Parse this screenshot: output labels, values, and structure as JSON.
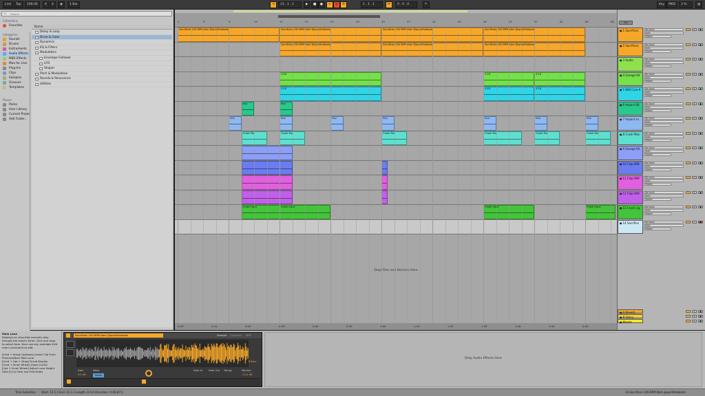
{
  "transport": {
    "link": "Link",
    "tap": "Tap",
    "tempo": "108.00",
    "sig_num": "4",
    "sig_den": "4",
    "metro": "1 Bar",
    "pos": "13 . 1 . 1",
    "loop_start": "1 . 1 . 1",
    "loop_len": "9 . 0 . 0",
    "key": "Key",
    "midi": "MIDI",
    "cpu": "3 %"
  },
  "browser": {
    "search_placeholder": "Search",
    "collections_title": "Collections",
    "favorites": "Favorites",
    "categories_title": "Categories",
    "categories": [
      "Sounds",
      "Drums",
      "Instruments",
      "Audio Effects",
      "MIDI Effects",
      "Max for Live",
      "Plug-Ins",
      "Clips",
      "Samples",
      "Grooves",
      "Templates"
    ],
    "selected_category": "Audio Effects",
    "places_title": "Places",
    "places": [
      "Packs",
      "User Library",
      "Current Project",
      "Add Folder..."
    ],
    "tree_header": "Name",
    "tree": [
      "Delay & Loop",
      "Drive & Color",
      "Dynamics",
      "EQ & Filters",
      "Modulators",
      "Envelope Follower",
      "LFO",
      "Shaper",
      "Pitch & Modulation",
      "Reverb & Resonance",
      "Utilities"
    ],
    "tree_selected": "Drive & Color"
  },
  "ruler": {
    "bars": [
      "1",
      "5",
      "9",
      "13",
      "17",
      "21",
      "25",
      "29",
      "33",
      "37",
      "41",
      "45",
      "49",
      "53",
      "57",
      "61",
      "65",
      "69"
    ],
    "times": [
      "0:00",
      "0:10",
      "0:20",
      "0:30",
      "0:40",
      "0:50",
      "1:00",
      "1:10",
      "1:20",
      "1:30",
      "1:40",
      "1:50",
      "2:00"
    ]
  },
  "clips": {
    "sacrifice": "Sacrifices 100 BPM 8bm @aprilithebeats",
    "kick": "4 Kit",
    "imp": "Imp",
    "crash": "Crash Mo",
    "crash_light": "Crash Light"
  },
  "drop_files": "Drop Files and Devices Here",
  "tracks": [
    {
      "name": "1 Sacrifices",
      "color": "#f6a72a"
    },
    {
      "name": "2 Sacrifices",
      "color": "#f6a72a"
    },
    {
      "name": "3 Audio",
      "color": "#8ee04d"
    },
    {
      "name": "4 Garage Kit",
      "color": "#74e04a"
    },
    {
      "name": "5 808 Core K",
      "color": "#2fd4e6"
    },
    {
      "name": "6 Impact 08",
      "color": "#28c98c"
    },
    {
      "name": "7 Impact Lo",
      "color": "#8fb8f0"
    },
    {
      "name": "8 Crash Man",
      "color": "#5ee0d0"
    },
    {
      "name": "9 Garage Kit",
      "color": "#8c9ef5"
    },
    {
      "name": "10 Clap 808",
      "color": "#6a7cf0"
    },
    {
      "name": "11 Clap 909",
      "color": "#e060e0"
    },
    {
      "name": "12 Clap 909",
      "color": "#c060e8"
    },
    {
      "name": "13 Crash Lig",
      "color": "#43c43a"
    },
    {
      "name": "14 Sacrifice",
      "color": "#cde8f5"
    }
  ],
  "returns": [
    {
      "name": "A Reverb",
      "color": "#f6a72a"
    },
    {
      "name": "B Delay",
      "color": "#f6d32a"
    },
    {
      "name": "Master",
      "color": "#f6e92a"
    }
  ],
  "mixer_labels": {
    "input": "No Input",
    "output": "Master",
    "auto": "Auto",
    "in": "In",
    "off": "Off",
    "solo": "S"
  },
  "info": {
    "title": "Main Lane",
    "lines": [
      "Displays an clips that normally play",
      "through the track's timer. Click and drag",
      "to select time, then use any available Edit",
      "menu command to edit.",
      "",
      "[Cmd + Arrow Up/Down] Insert Clip From",
      "Previous/Next Take Lane",
      "[Cmd + Opt + Drag] Scrub Display",
      "[Cmd + Scroll Wheel] Zoom In/Out",
      "[Opt + Scroll Wheel] Adjust Lane Height",
      "Hold [F] to View and Edit Fades"
    ]
  },
  "clip_view": {
    "name": "Sacrifices 100 BPM 8bm @aprilithebeats",
    "tabs": [
      "Sample",
      "Controls",
      "MPE"
    ],
    "gain_label": "Gain",
    "gain": "0.0 dB",
    "warp_label": "Warp",
    "beats": "Beats",
    "fade_in_label": "Fade In",
    "fade_out_label": "Fade Out",
    "transpose_label": "Transp",
    "volume_label": "Volume",
    "volume": "-12.0 dB",
    "bars": "8 Bars"
  },
  "fx_drop": "Drop Audio Effects Here",
  "status": {
    "left": "Time Selection",
    "start": "Start: 13.1.1",
    "end": "End: 21.1.1",
    "length": "Length: 8.0.0 (Duration: 0:08.871)",
    "right": "14-Sacrifices 100 BPM 8bm @aprilithebeats"
  }
}
